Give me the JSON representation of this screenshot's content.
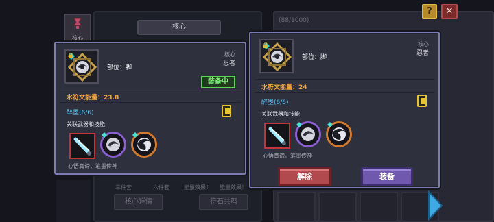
{
  "window": {
    "core_label": "核心",
    "core_tab": "核心",
    "inventory_count": "(88/1000)",
    "help_label": "?",
    "close_label": "✕"
  },
  "background": {
    "stats": [
      "三件套",
      "六件套",
      "能量效果！",
      "能量效果！"
    ],
    "buttons": {
      "core_detail": "核心详情",
      "rune_resonance": "符石共鸣"
    }
  },
  "left_card": {
    "part_label": "部位：脚",
    "type_category": "核心",
    "type_class": "忍者",
    "equipped_badge": "装备中",
    "energy_text": "水符文能量：23.8",
    "ink_text": "醉墨(6/6)",
    "related_title": "关联武器和技能",
    "description": "心悟真谛，笔墨传神"
  },
  "right_card": {
    "part_label": "部位：脚",
    "type_category": "核心",
    "type_class": "忍者",
    "energy_text": "水符文能量：24",
    "ink_text": "醉墨(6/6)",
    "related_title": "关联武器和技能",
    "description": "心悟真谛，笔墨传神",
    "remove_button": "解除",
    "equip_button": "装备"
  },
  "icons": {
    "item": "ink-core-rune-icon",
    "rarity": "cyan-gem-icon",
    "lock": "lock-icon",
    "weapon": "ink-brush-weapon-icon",
    "skill_1": "ink-swirl-skill-icon",
    "skill_2": "ink-whirl-skill-icon",
    "ink_stat": "ink-bottle-icon"
  },
  "colors": {
    "card_border": "#7c7dae",
    "energy": "#f3a63a",
    "ink": "#5ec3f2",
    "equipped": "#5fd25a",
    "remove": "#b04a4f",
    "equip": "#6f58ad"
  }
}
